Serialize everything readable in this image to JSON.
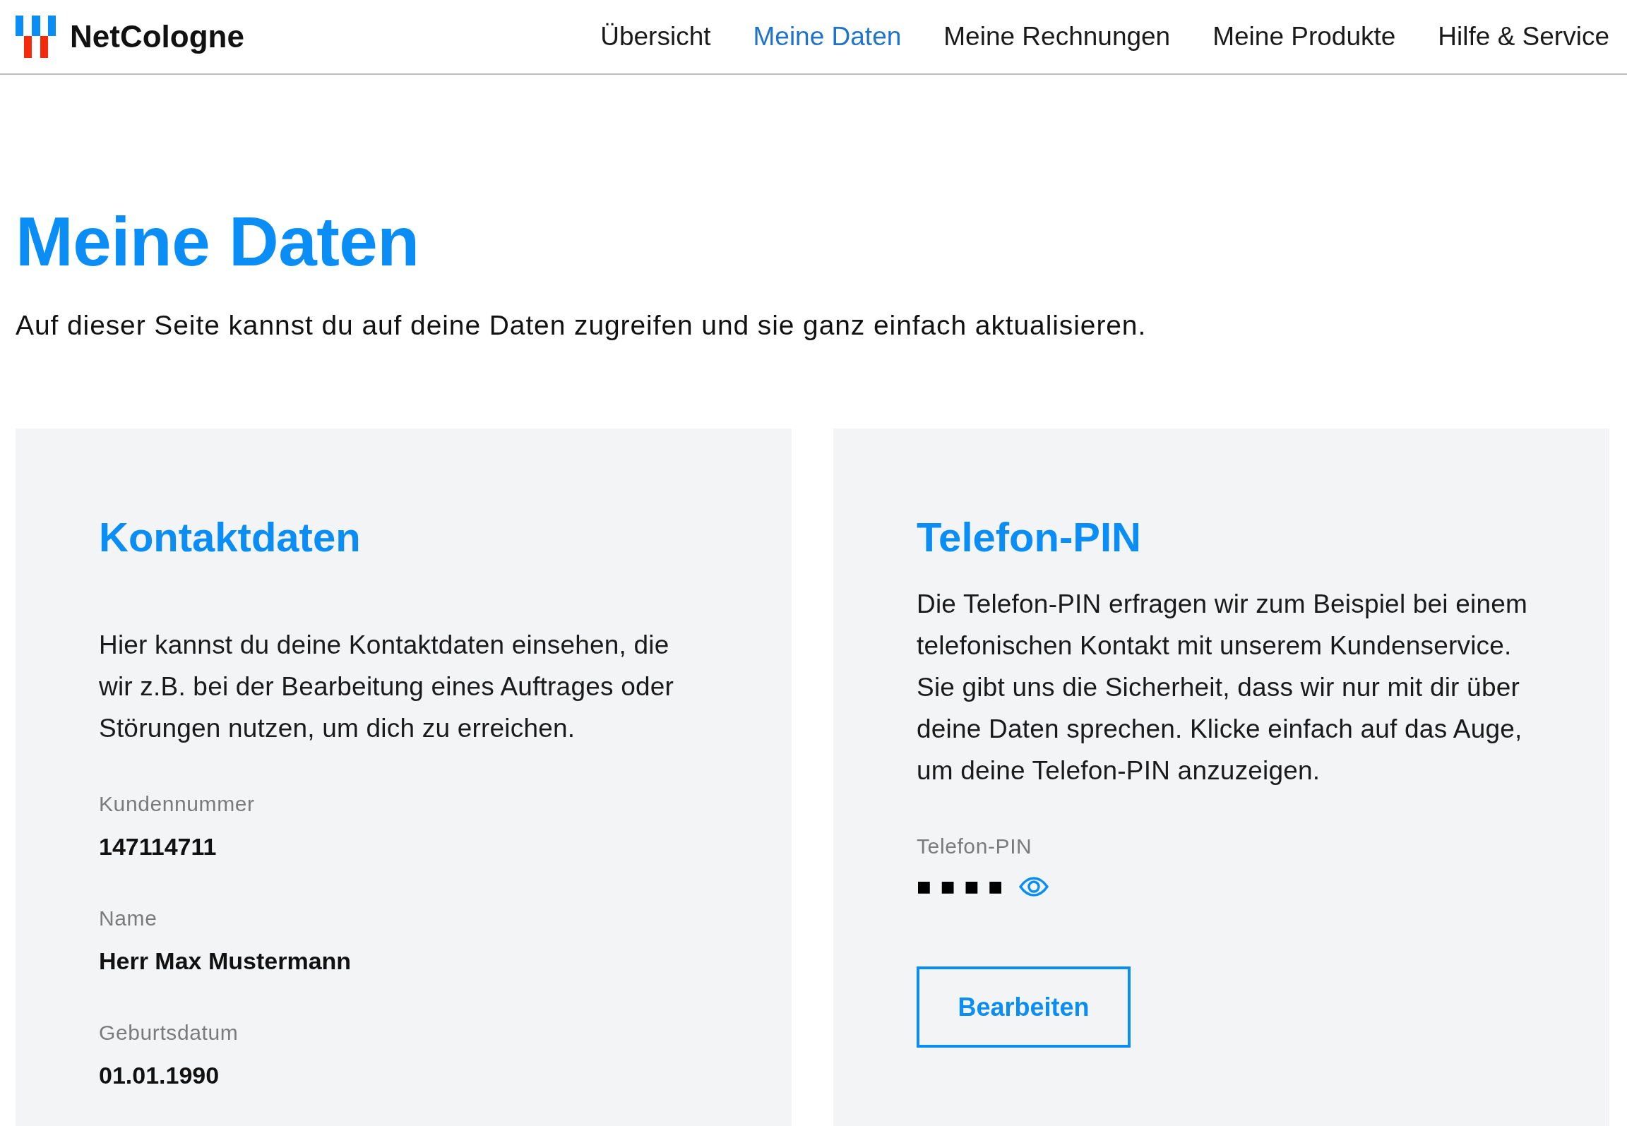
{
  "header": {
    "logo": {
      "text": "NetCologne"
    },
    "nav": [
      {
        "label": "Übersicht",
        "selected": false
      },
      {
        "label": "Meine Daten",
        "selected": true
      },
      {
        "label": "Meine Rechnungen",
        "selected": false
      },
      {
        "label": "Meine Produkte",
        "selected": false
      },
      {
        "label": "Hilfe & Service",
        "selected": false
      }
    ]
  },
  "page": {
    "title": "Meine Daten",
    "intro": "Auf dieser Seite kannst du auf deine Daten zugreifen und sie ganz einfach aktualisieren."
  },
  "contact_card": {
    "title": "Kontaktdaten",
    "description": "Hier kannst du deine Kontaktdaten einsehen, die wir z.B. bei der Bearbeitung eines Auftrages oder Störungen nutzen, um dich zu erreichen.",
    "fields": [
      {
        "label": "Kundennummer",
        "value": "147114711"
      },
      {
        "label": "Name",
        "value": "Herr Max Mustermann"
      },
      {
        "label": "Geburtsdatum",
        "value": "01.01.1990"
      }
    ]
  },
  "pin_card": {
    "title": "Telefon-PIN",
    "description": "Die Telefon-PIN erfragen wir zum Beispiel bei einem telefonischen Kontakt mit unserem Kundenservice. Sie gibt uns die Sicherheit, dass wir nur mit dir über deine Daten sprechen. Klicke einfach auf das Auge, um deine Telefon-PIN anzuzeigen.",
    "pin_field": {
      "label": "Telefon-PIN",
      "masked_value": "■■■■"
    },
    "button": "Bearbeiten"
  }
}
